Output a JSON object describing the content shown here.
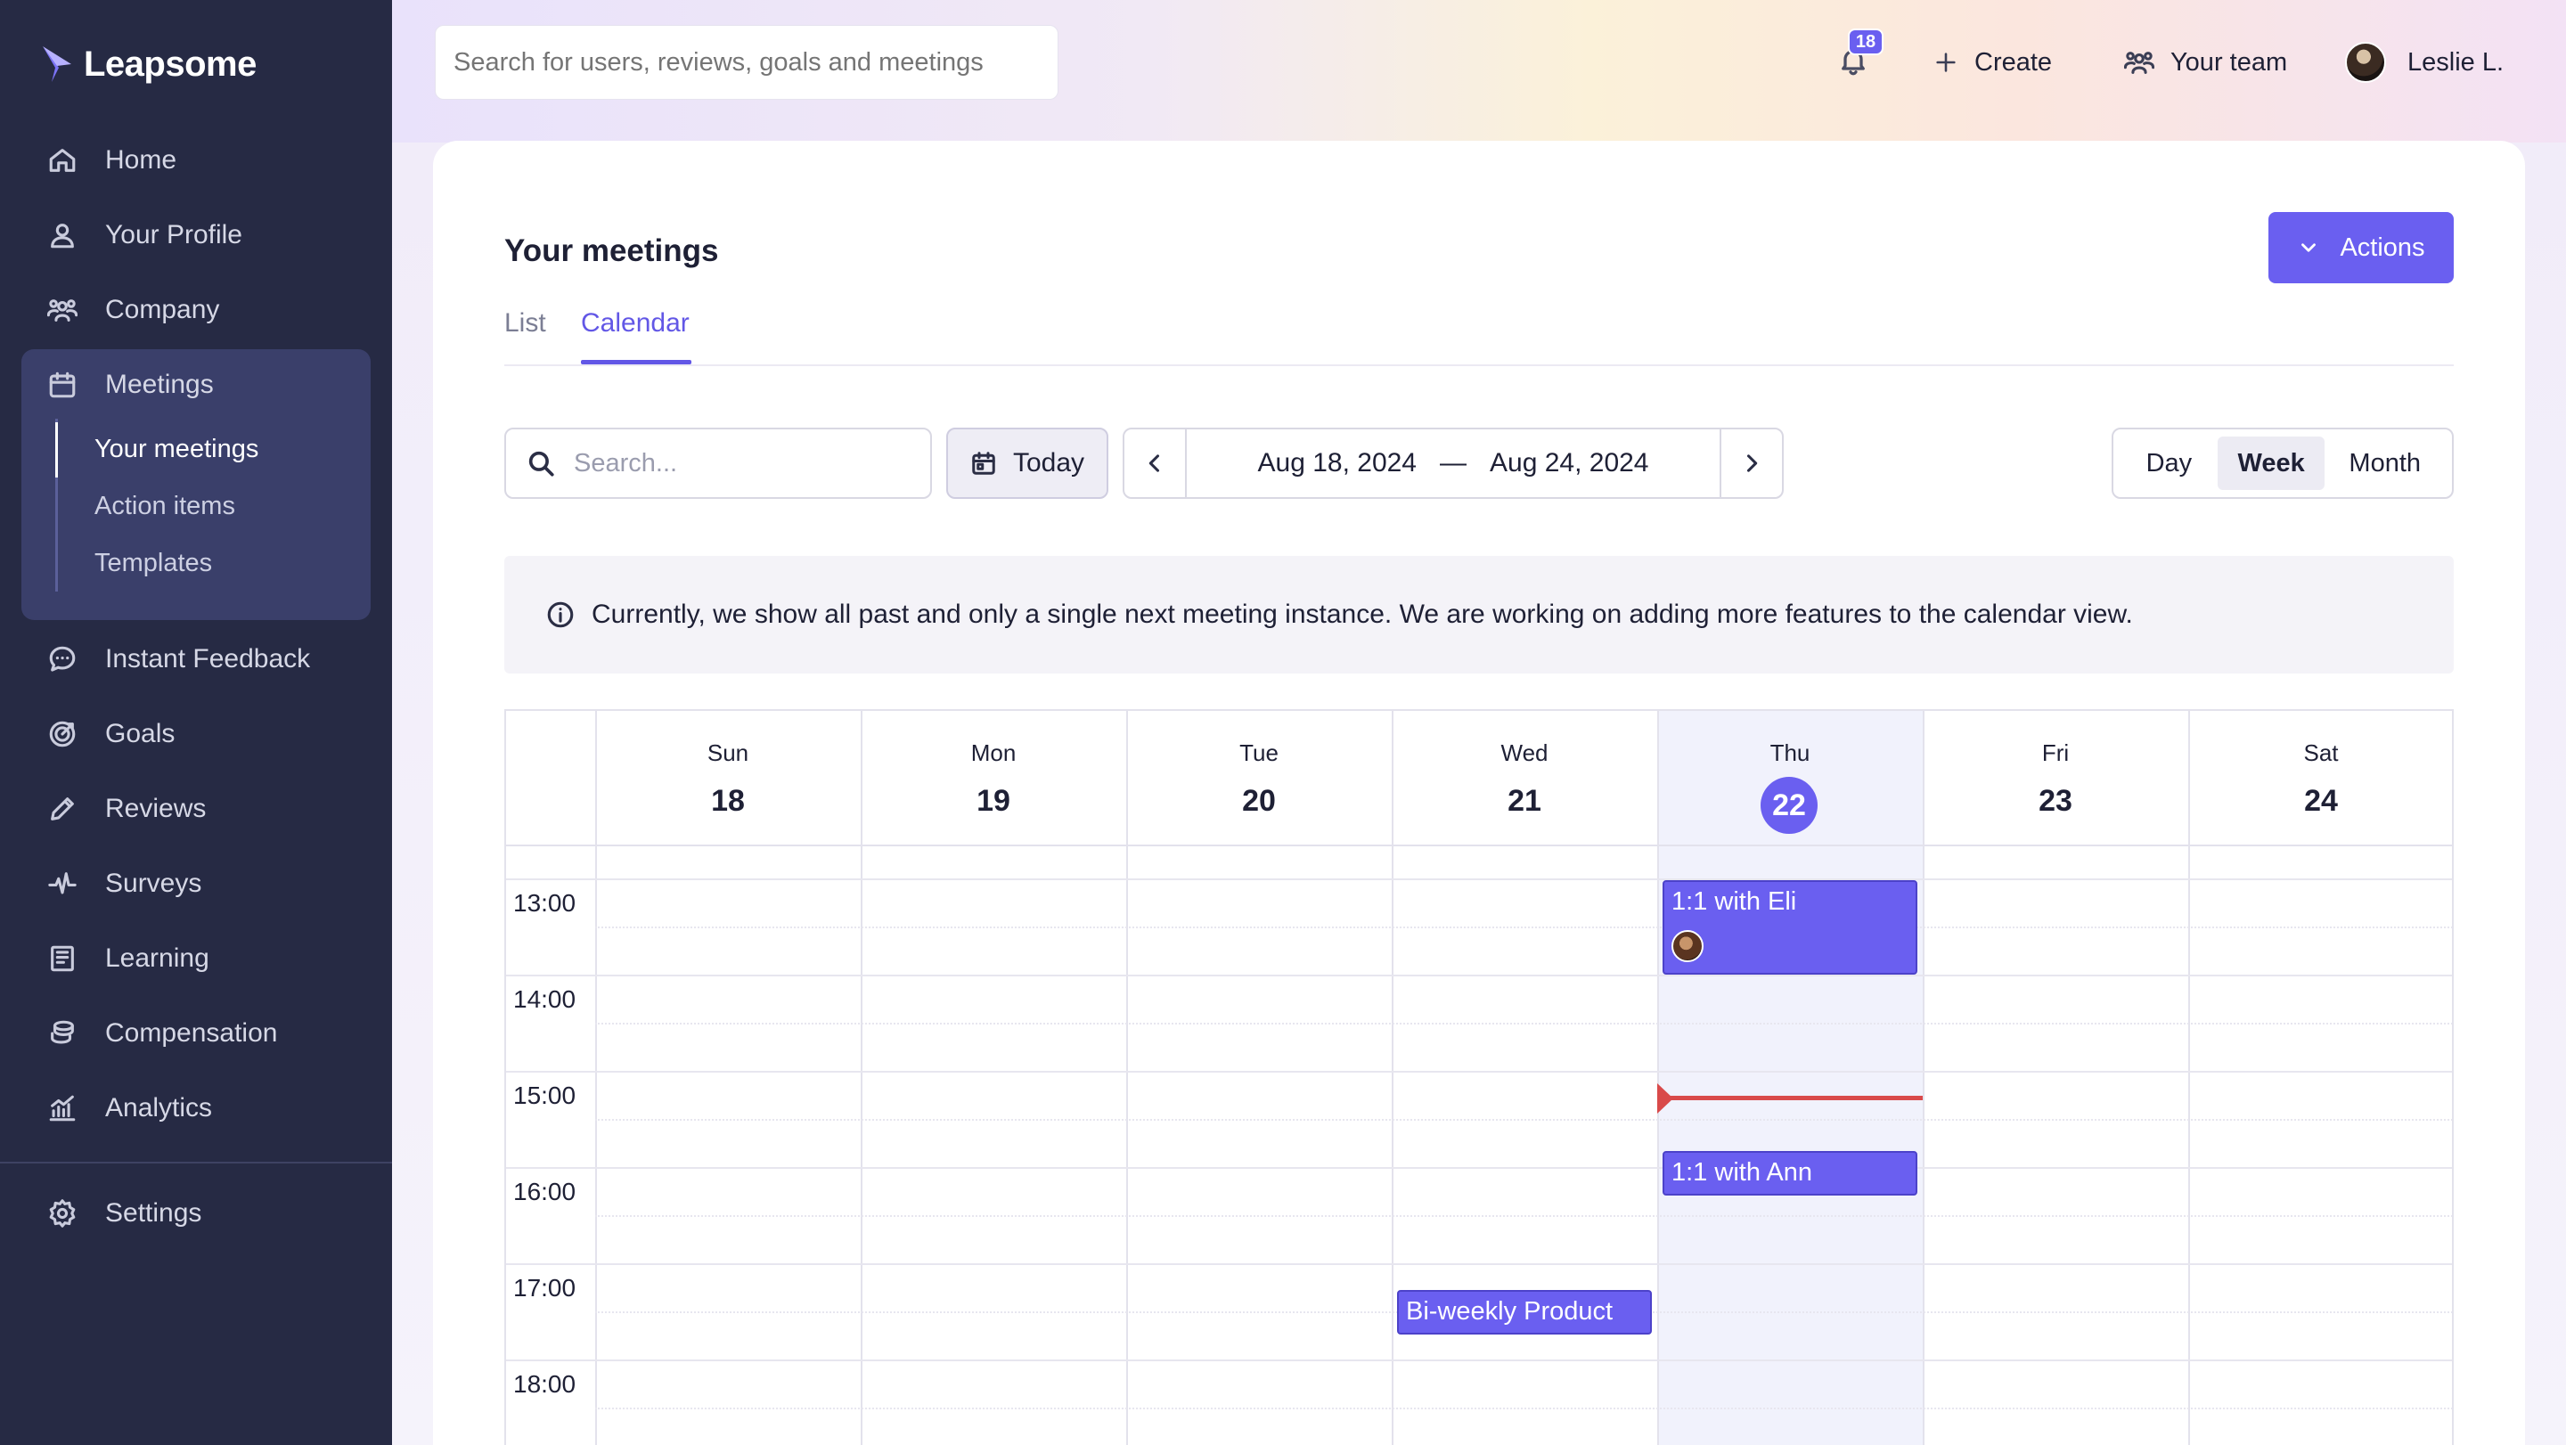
{
  "app": {
    "name": "Leapsome"
  },
  "sidebar": {
    "items": [
      {
        "label": "Home",
        "icon": "home-icon"
      },
      {
        "label": "Your Profile",
        "icon": "user-icon"
      },
      {
        "label": "Company",
        "icon": "people-icon"
      },
      {
        "label": "Meetings",
        "icon": "calendar-icon"
      },
      {
        "label": "Instant Feedback",
        "icon": "chat-icon"
      },
      {
        "label": "Goals",
        "icon": "target-icon"
      },
      {
        "label": "Reviews",
        "icon": "pencil-icon"
      },
      {
        "label": "Surveys",
        "icon": "pulse-icon"
      },
      {
        "label": "Learning",
        "icon": "book-icon"
      },
      {
        "label": "Compensation",
        "icon": "coins-icon"
      },
      {
        "label": "Analytics",
        "icon": "chart-icon"
      }
    ],
    "meetings_sub": [
      {
        "label": "Your meetings",
        "active": true
      },
      {
        "label": "Action items"
      },
      {
        "label": "Templates"
      }
    ],
    "settings": {
      "label": "Settings",
      "icon": "gear-icon"
    }
  },
  "topbar": {
    "search_placeholder": "Search for users, reviews, goals and meetings",
    "notifications_count": "18",
    "create_label": "Create",
    "team_label": "Your team",
    "user_name": "Leslie L."
  },
  "page": {
    "title": "Your meetings",
    "actions_label": "Actions",
    "tabs": [
      {
        "label": "List"
      },
      {
        "label": "Calendar",
        "active": true
      }
    ]
  },
  "toolbar": {
    "search_placeholder": "Search...",
    "today_label": "Today",
    "range_start": "Aug 18, 2024",
    "range_separator": "—",
    "range_end": "Aug 24, 2024",
    "views": [
      {
        "label": "Day"
      },
      {
        "label": "Week",
        "active": true
      },
      {
        "label": "Month"
      }
    ]
  },
  "info_banner": {
    "text": "Currently, we show all past and only a single next meeting instance. We are working on adding more features to the calendar view."
  },
  "calendar": {
    "days": [
      {
        "name": "Sun",
        "num": "18"
      },
      {
        "name": "Mon",
        "num": "19"
      },
      {
        "name": "Tue",
        "num": "20"
      },
      {
        "name": "Wed",
        "num": "21"
      },
      {
        "name": "Thu",
        "num": "22",
        "today": true
      },
      {
        "name": "Fri",
        "num": "23"
      },
      {
        "name": "Sat",
        "num": "24"
      }
    ],
    "times": [
      "13:00",
      "14:00",
      "15:00",
      "16:00",
      "17:00",
      "18:00"
    ],
    "events": [
      {
        "title": "1:1 with Eli",
        "day": "Thu",
        "start": "13:00",
        "end": "14:00",
        "has_avatar": true
      },
      {
        "title": "1:1 with Ann",
        "day": "Thu",
        "start": "15:45",
        "end": "16:15"
      },
      {
        "title": "Bi-weekly Product",
        "day": "Wed",
        "start": "17:15",
        "end": "17:45"
      }
    ],
    "current_time": "15:15",
    "accent_color": "#6a5ff0",
    "now_color": "#d94a4a"
  },
  "colors": {
    "sidebar_bg": "#262a44",
    "accent": "#6a5ff0"
  }
}
